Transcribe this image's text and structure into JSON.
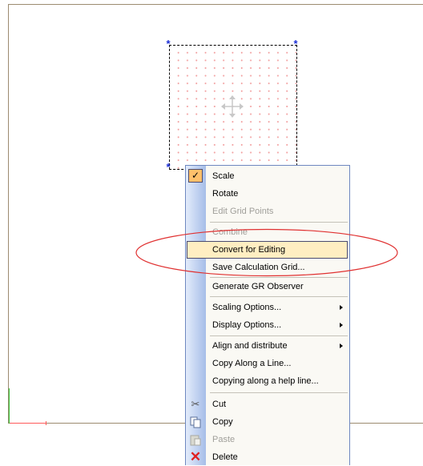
{
  "menu": {
    "items": [
      {
        "label": "Scale",
        "checked": true
      },
      {
        "label": "Rotate"
      },
      {
        "label": "Edit Grid Points",
        "disabled": true
      },
      {
        "label": "Combine",
        "disabled": true
      },
      {
        "label": "Convert for Editing",
        "highlighted": true
      },
      {
        "label": "Save Calculation Grid..."
      },
      {
        "label": "Generate GR Observer"
      },
      {
        "label": "Scaling Options...",
        "submenu": true
      },
      {
        "label": "Display Options...",
        "submenu": true
      },
      {
        "label": "Align and distribute",
        "submenu": true
      },
      {
        "label": "Copy Along a Line..."
      },
      {
        "label": "Copying along a help line..."
      },
      {
        "label": "Cut",
        "icon": "scissors-icon"
      },
      {
        "label": "Copy",
        "icon": "copy-icon"
      },
      {
        "label": "Paste",
        "icon": "paste-icon",
        "disabled": true
      },
      {
        "label": "Delete",
        "icon": "delete-icon"
      }
    ]
  },
  "colors": {
    "highlight": "#ffeec2",
    "annotation": "#e03131",
    "handle": "#1c2fd6"
  }
}
